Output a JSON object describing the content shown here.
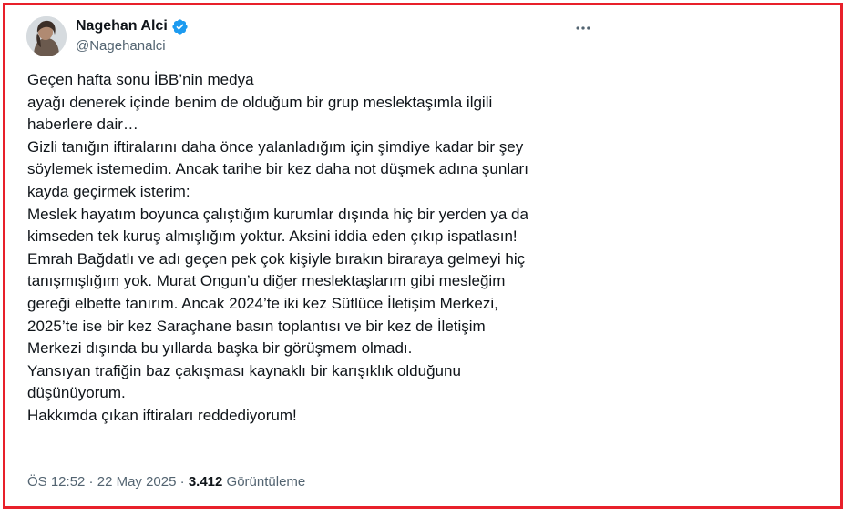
{
  "author": {
    "name": "Nagehan Alci",
    "handle": "@Nagehanalci",
    "verified_icon": "verified-badge-icon",
    "avatar_icon": "avatar"
  },
  "menu": {
    "more_icon": "more-options-icon"
  },
  "tweet": {
    "lines": [
      "Geçen hafta sonu İBB’nin  medya",
      "ayağı denerek içinde benim de olduğum bir grup meslektaşımla ilgili",
      "haberlere dair…",
      "Gizli tanığın iftiralarını daha önce yalanladığım için şimdiye kadar bir şey",
      "söylemek istemedim. Ancak tarihe bir kez daha not düşmek adına şunları",
      "kayda geçirmek isterim:",
      "Meslek hayatım boyunca çalıştığım kurumlar dışında hiç bir yerden ya da",
      "kimseden tek kuruş almışlığım yoktur. Aksini iddia eden çıkıp ispatlasın!",
      "Emrah Bağdatlı ve adı geçen pek çok kişiyle bırakın biraraya gelmeyi hiç",
      "tanışmışlığım  yok. Murat Ongun’u diğer meslektaşlarım gibi mesleğim",
      "gereği elbette tanırım. Ancak 2024’te iki kez Sütlüce İletişim Merkezi,",
      "2025’te ise bir kez Saraçhane basın toplantısı ve bir kez de İletişim",
      "Merkezi dışında bu yıllarda başka bir görüşmem olmadı.",
      "Yansıyan trafiğin baz çakışması kaynaklı bir karışıklık  olduğunu",
      "düşünüyorum.",
      "Hakkımda çıkan iftiraları reddediyorum!"
    ]
  },
  "meta": {
    "time": "ÖS 12:52",
    "separator": " · ",
    "date": "22 May 2025",
    "views_count": "3.412",
    "views_label": "Görüntüleme"
  },
  "colors": {
    "frame_border": "#e8202a",
    "verified_blue": "#1d9bf0",
    "text_primary": "#0f1419",
    "text_secondary": "#536471"
  }
}
